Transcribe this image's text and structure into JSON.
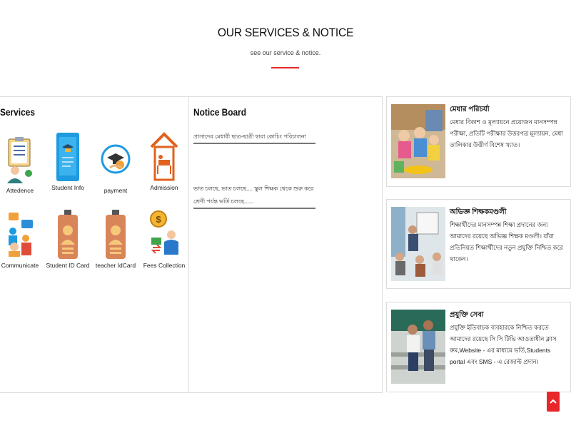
{
  "header": {
    "title": "OUR SERVICES & NOTICE",
    "subtitle": "see our service & notice."
  },
  "services": {
    "title": "Services",
    "items": [
      {
        "label": "Attedence",
        "icon": "attendance-icon"
      },
      {
        "label": "Student Info",
        "icon": "student-info-icon"
      },
      {
        "label": "payment",
        "icon": "payment-icon"
      },
      {
        "label": "Admission",
        "icon": "admission-icon"
      },
      {
        "label": "Communicate",
        "icon": "communicate-icon"
      },
      {
        "label": "Student ID Card",
        "icon": "student-id-card-icon"
      },
      {
        "label": "teacher IdCard",
        "icon": "teacher-id-card-icon"
      },
      {
        "label": "Fees Collection",
        "icon": "fees-collection-icon"
      }
    ]
  },
  "notice": {
    "title": "Notice Board",
    "items": [
      {
        "text": "প্রাসাদের মেধাবী ছাত্র-ছাত্রী দ্বারা কোচিং পরিচালনা"
      },
      {
        "text": "ভাত চলছে, ভাত চলছে.... স্কুল শিক্ষক থেকে শুরু করে শ্রেণী পর্যন্ত ভর্তি চলছে......"
      }
    ]
  },
  "cards": [
    {
      "title": "মেধার পরিচর্যা",
      "text": "মেধার বিকাশ ও মূল্যায়নে প্রয়োজন মানসম্পন্ন পরীক্ষা, প্রতিটি পরীক্ষার উত্তরপত্র মূল্যায়ন, মেধা তালিকার উত্তীর্ণ বিশেষ খ্যাত।"
    },
    {
      "title": "অভিজ্ঞ শিক্ষকমণ্ডলী",
      "text": "শিক্ষার্থীদের মানসম্পন্ন শিক্ষা প্রদানের জন্য আমাদের রয়েছে অভিজ্ঞ শিক্ষক মণ্ডলী। যাঁরা প্রতিনিয়ত শিক্ষার্থীদের নতুন প্রযুক্তি নিশ্চিত করে থাকেন।"
    },
    {
      "title": "প্রযুক্তি সেবা",
      "text": "প্রযুক্তি ইতিবাচক ব্যবহারকে নিশ্চিত করতে আমাদের রয়েছে সি সি টিভি আওতাধীন ক্লাস রুম,Website - এর মাধ্যমে ভর্তি,Students portal এবং SMS - এ রেজাল্ট প্রদান।"
    }
  ],
  "colors": {
    "accent": "#e8262a",
    "border": "#dcdcdc"
  },
  "scroll_top_icon": "chevron-up-icon"
}
